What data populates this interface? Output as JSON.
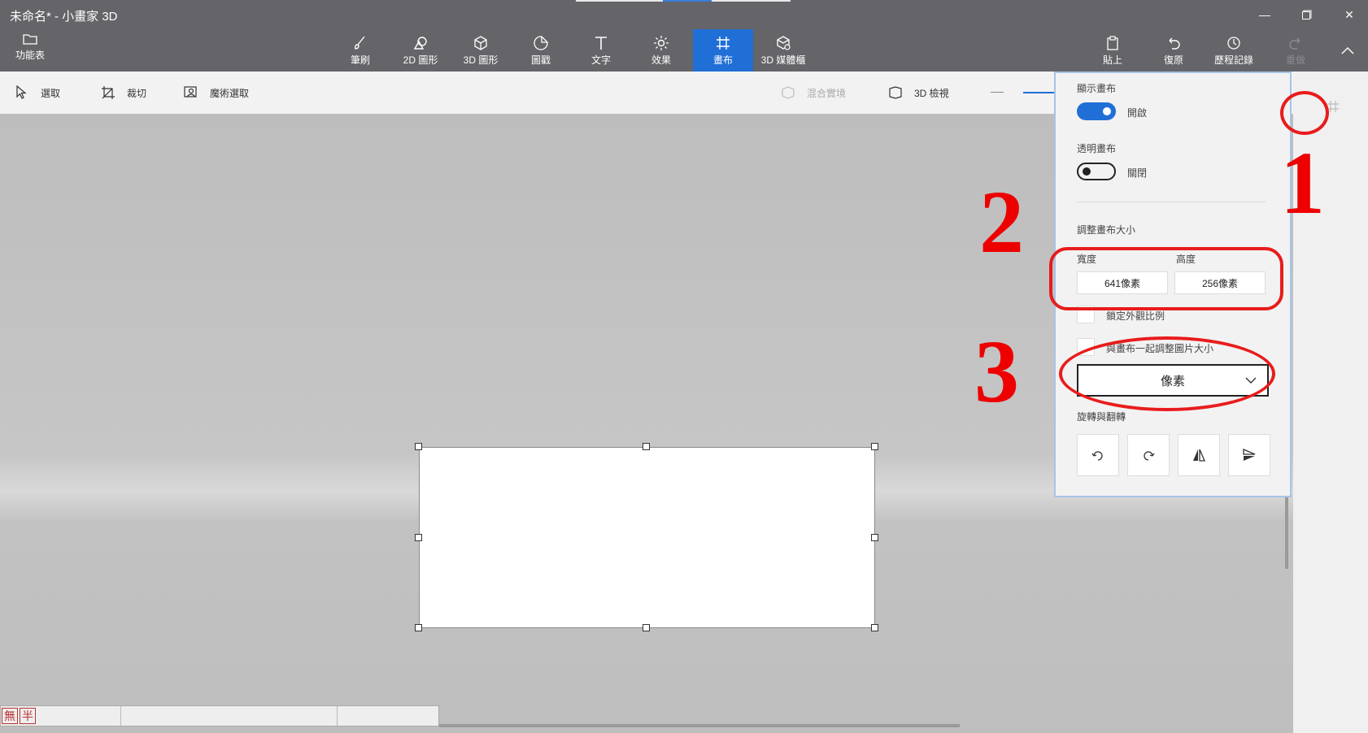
{
  "window": {
    "title": "未命名* - 小畫家 3D",
    "controls": [
      "minimize-icon",
      "maximize-icon",
      "close-icon"
    ]
  },
  "menu": {
    "label": "功能表"
  },
  "toolbar": {
    "tools": [
      {
        "label": "筆刷",
        "icon": "brush-icon"
      },
      {
        "label": "2D 圖形",
        "icon": "2d-shapes-icon"
      },
      {
        "label": "3D 圖形",
        "icon": "3d-shapes-icon"
      },
      {
        "label": "圖戳",
        "icon": "sticker-icon"
      },
      {
        "label": "文字",
        "icon": "text-icon"
      },
      {
        "label": "效果",
        "icon": "effects-icon"
      },
      {
        "label": "畫布",
        "icon": "canvas-icon",
        "active": true
      },
      {
        "label": "3D 媒體櫃",
        "icon": "3d-library-icon"
      }
    ],
    "right": [
      {
        "label": "貼上",
        "icon": "paste-icon"
      },
      {
        "label": "復原",
        "icon": "undo-icon"
      },
      {
        "label": "歷程記錄",
        "icon": "history-icon"
      },
      {
        "label": "重做",
        "icon": "redo-icon",
        "disabled": true
      }
    ],
    "collapse_icon": "chevron-up-icon"
  },
  "subbar": {
    "select": "選取",
    "crop": "裁切",
    "magic_select": "魔術選取",
    "mixed_reality": "混合實境",
    "view_3d": "3D 檢視"
  },
  "panel": {
    "show_canvas_label": "顯示畫布",
    "show_canvas_state": "開啟",
    "show_canvas_on": true,
    "transparent_label": "透明畫布",
    "transparent_state": "關閉",
    "transparent_on": false,
    "resize_label": "調整畫布大小",
    "width_label": "寬度",
    "height_label": "高度",
    "width_value": "641像素",
    "height_value": "256像素",
    "lock_aspect": "鎖定外觀比例",
    "resize_image": "與畫布一起調整圖片大小",
    "unit": "像素",
    "rotate_label": "旋轉與翻轉",
    "rotate_buttons": [
      "rotate-left-icon",
      "rotate-right-icon",
      "flip-horizontal-icon",
      "flip-vertical-icon"
    ]
  },
  "annotations": {
    "numbers": [
      "1",
      "2",
      "3"
    ],
    "color": "#e81c1c"
  },
  "statusbar": {
    "ime1": "無",
    "ime2": "半"
  },
  "colors": {
    "accent": "#1f6fd6",
    "titlebar": "#646469"
  }
}
